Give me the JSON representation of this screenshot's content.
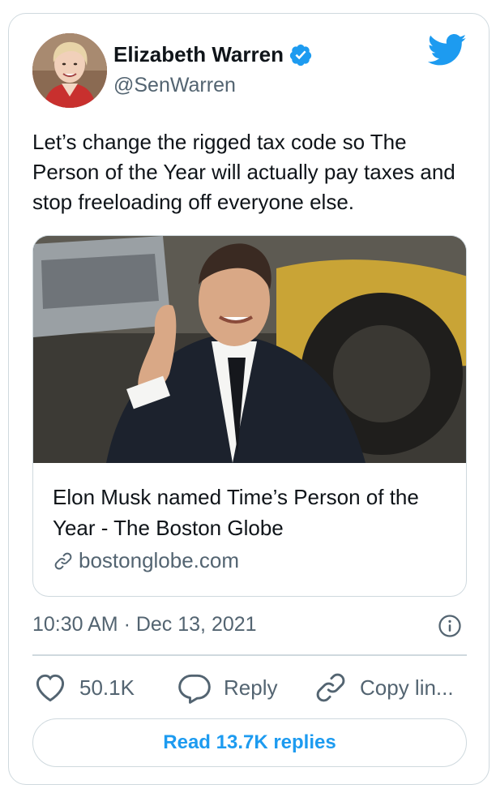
{
  "author": {
    "name": "Elizabeth Warren",
    "handle": "@SenWarren",
    "verified": true
  },
  "tweet": {
    "text": "Let’s change the rigged tax code so The Person of the Year will actually pay taxes and stop freeloading off everyone else."
  },
  "link_card": {
    "title": "Elon Musk named Time’s Person of the Year - The Boston Globe",
    "domain": "bostonglobe.com"
  },
  "meta": {
    "timestamp": "10:30 AM · Dec 13, 2021"
  },
  "actions": {
    "likes": "50.1K",
    "reply_label": "Reply",
    "copy_label": "Copy lin..."
  },
  "read_replies_label": "Read 13.7K replies",
  "colors": {
    "accent": "#1d9bf0",
    "text": "#0f1419",
    "muted": "#536471",
    "border": "#cfd9de"
  }
}
